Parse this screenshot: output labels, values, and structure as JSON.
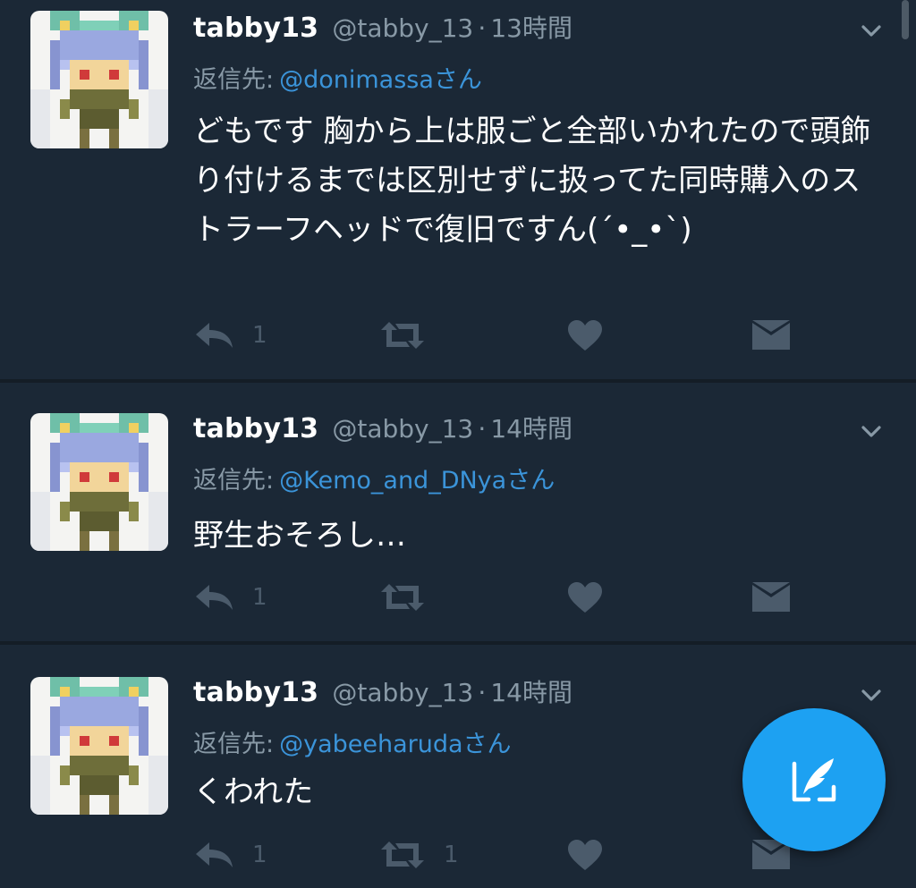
{
  "tweets": [
    {
      "name": "tabby13",
      "handle": "@tabby_13",
      "separator": "·",
      "time": "13時間",
      "reply_label": "返信先:",
      "reply_user": "@donimassaさん",
      "text": "どもです 胸から上は服ごと全部いかれたので頭飾り付けるまでは区別せずに扱ってた同時購入のストラーフヘッドで復旧ですん(´•_•`)",
      "reply_count": "1",
      "retweet_count": "",
      "icons": [
        "reply-icon",
        "retweet-icon",
        "like-icon",
        "direct-message-icon",
        "chevron-down-icon"
      ]
    },
    {
      "name": "tabby13",
      "handle": "@tabby_13",
      "separator": "·",
      "time": "14時間",
      "reply_label": "返信先:",
      "reply_user": "@Kemo_and_DNyaさん",
      "text": "野生おそろし…",
      "reply_count": "1",
      "retweet_count": "",
      "icons": [
        "reply-icon",
        "retweet-icon",
        "like-icon",
        "direct-message-icon",
        "chevron-down-icon"
      ]
    },
    {
      "name": "tabby13",
      "handle": "@tabby_13",
      "separator": "·",
      "time": "14時間",
      "reply_label": "返信先:",
      "reply_user": "@yabeeharudaさん",
      "text": "くわれた",
      "reply_count": "1",
      "retweet_count": "1",
      "icons": [
        "reply-icon",
        "retweet-icon",
        "like-icon",
        "direct-message-icon",
        "chevron-down-icon"
      ]
    }
  ],
  "fab": {
    "icon": "compose-tweet-icon"
  },
  "colors": {
    "background": "#141d26",
    "card": "#1b2836",
    "accent": "#1da1f2",
    "link": "#3b94d9",
    "muted": "#8899a6",
    "icon": "#4b5b6b"
  }
}
